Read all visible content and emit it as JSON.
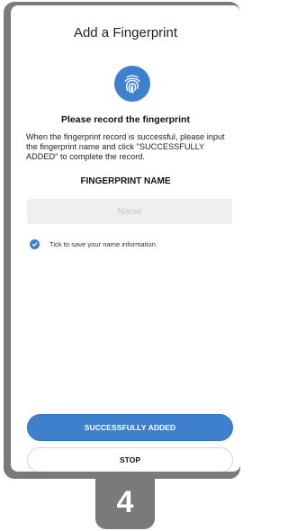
{
  "screen": {
    "title": "Add a Fingerprint",
    "subtitle": "Please record the fingerprint",
    "description": "When the fingerprint record is successful, please input the fingerprint name and click \"SUCCESSFULLY ADDED\"  to complete the record.",
    "name_heading": "FINGERPRINT NAME",
    "name_field": {
      "value": "",
      "placeholder": "Name"
    },
    "save_info": {
      "checked": true,
      "label": "Tick to save your name information."
    },
    "buttons": {
      "primary": "SUCCESSFULLY ADDED",
      "secondary": "STOP"
    },
    "icons": {
      "fingerprint": "fingerprint-icon",
      "checkmark": "checkmark-icon"
    }
  },
  "step_number": "4",
  "colors": {
    "accent": "#3f80cd",
    "frame": "#7a7a7a"
  }
}
